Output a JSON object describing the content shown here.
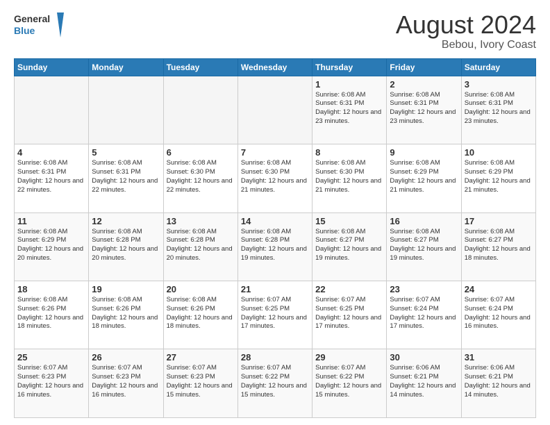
{
  "logo": {
    "line1": "General",
    "line2": "Blue"
  },
  "header": {
    "month": "August 2024",
    "location": "Bebou, Ivory Coast"
  },
  "days_of_week": [
    "Sunday",
    "Monday",
    "Tuesday",
    "Wednesday",
    "Thursday",
    "Friday",
    "Saturday"
  ],
  "weeks": [
    [
      {
        "day": "",
        "sunrise": "",
        "sunset": "",
        "daylight": ""
      },
      {
        "day": "",
        "sunrise": "",
        "sunset": "",
        "daylight": ""
      },
      {
        "day": "",
        "sunrise": "",
        "sunset": "",
        "daylight": ""
      },
      {
        "day": "",
        "sunrise": "",
        "sunset": "",
        "daylight": ""
      },
      {
        "day": "1",
        "sunrise": "Sunrise: 6:08 AM",
        "sunset": "Sunset: 6:31 PM",
        "daylight": "Daylight: 12 hours and 23 minutes."
      },
      {
        "day": "2",
        "sunrise": "Sunrise: 6:08 AM",
        "sunset": "Sunset: 6:31 PM",
        "daylight": "Daylight: 12 hours and 23 minutes."
      },
      {
        "day": "3",
        "sunrise": "Sunrise: 6:08 AM",
        "sunset": "Sunset: 6:31 PM",
        "daylight": "Daylight: 12 hours and 23 minutes."
      }
    ],
    [
      {
        "day": "4",
        "sunrise": "Sunrise: 6:08 AM",
        "sunset": "Sunset: 6:31 PM",
        "daylight": "Daylight: 12 hours and 22 minutes."
      },
      {
        "day": "5",
        "sunrise": "Sunrise: 6:08 AM",
        "sunset": "Sunset: 6:31 PM",
        "daylight": "Daylight: 12 hours and 22 minutes."
      },
      {
        "day": "6",
        "sunrise": "Sunrise: 6:08 AM",
        "sunset": "Sunset: 6:30 PM",
        "daylight": "Daylight: 12 hours and 22 minutes."
      },
      {
        "day": "7",
        "sunrise": "Sunrise: 6:08 AM",
        "sunset": "Sunset: 6:30 PM",
        "daylight": "Daylight: 12 hours and 21 minutes."
      },
      {
        "day": "8",
        "sunrise": "Sunrise: 6:08 AM",
        "sunset": "Sunset: 6:30 PM",
        "daylight": "Daylight: 12 hours and 21 minutes."
      },
      {
        "day": "9",
        "sunrise": "Sunrise: 6:08 AM",
        "sunset": "Sunset: 6:29 PM",
        "daylight": "Daylight: 12 hours and 21 minutes."
      },
      {
        "day": "10",
        "sunrise": "Sunrise: 6:08 AM",
        "sunset": "Sunset: 6:29 PM",
        "daylight": "Daylight: 12 hours and 21 minutes."
      }
    ],
    [
      {
        "day": "11",
        "sunrise": "Sunrise: 6:08 AM",
        "sunset": "Sunset: 6:29 PM",
        "daylight": "Daylight: 12 hours and 20 minutes."
      },
      {
        "day": "12",
        "sunrise": "Sunrise: 6:08 AM",
        "sunset": "Sunset: 6:28 PM",
        "daylight": "Daylight: 12 hours and 20 minutes."
      },
      {
        "day": "13",
        "sunrise": "Sunrise: 6:08 AM",
        "sunset": "Sunset: 6:28 PM",
        "daylight": "Daylight: 12 hours and 20 minutes."
      },
      {
        "day": "14",
        "sunrise": "Sunrise: 6:08 AM",
        "sunset": "Sunset: 6:28 PM",
        "daylight": "Daylight: 12 hours and 19 minutes."
      },
      {
        "day": "15",
        "sunrise": "Sunrise: 6:08 AM",
        "sunset": "Sunset: 6:27 PM",
        "daylight": "Daylight: 12 hours and 19 minutes."
      },
      {
        "day": "16",
        "sunrise": "Sunrise: 6:08 AM",
        "sunset": "Sunset: 6:27 PM",
        "daylight": "Daylight: 12 hours and 19 minutes."
      },
      {
        "day": "17",
        "sunrise": "Sunrise: 6:08 AM",
        "sunset": "Sunset: 6:27 PM",
        "daylight": "Daylight: 12 hours and 18 minutes."
      }
    ],
    [
      {
        "day": "18",
        "sunrise": "Sunrise: 6:08 AM",
        "sunset": "Sunset: 6:26 PM",
        "daylight": "Daylight: 12 hours and 18 minutes."
      },
      {
        "day": "19",
        "sunrise": "Sunrise: 6:08 AM",
        "sunset": "Sunset: 6:26 PM",
        "daylight": "Daylight: 12 hours and 18 minutes."
      },
      {
        "day": "20",
        "sunrise": "Sunrise: 6:08 AM",
        "sunset": "Sunset: 6:26 PM",
        "daylight": "Daylight: 12 hours and 18 minutes."
      },
      {
        "day": "21",
        "sunrise": "Sunrise: 6:07 AM",
        "sunset": "Sunset: 6:25 PM",
        "daylight": "Daylight: 12 hours and 17 minutes."
      },
      {
        "day": "22",
        "sunrise": "Sunrise: 6:07 AM",
        "sunset": "Sunset: 6:25 PM",
        "daylight": "Daylight: 12 hours and 17 minutes."
      },
      {
        "day": "23",
        "sunrise": "Sunrise: 6:07 AM",
        "sunset": "Sunset: 6:24 PM",
        "daylight": "Daylight: 12 hours and 17 minutes."
      },
      {
        "day": "24",
        "sunrise": "Sunrise: 6:07 AM",
        "sunset": "Sunset: 6:24 PM",
        "daylight": "Daylight: 12 hours and 16 minutes."
      }
    ],
    [
      {
        "day": "25",
        "sunrise": "Sunrise: 6:07 AM",
        "sunset": "Sunset: 6:23 PM",
        "daylight": "Daylight: 12 hours and 16 minutes."
      },
      {
        "day": "26",
        "sunrise": "Sunrise: 6:07 AM",
        "sunset": "Sunset: 6:23 PM",
        "daylight": "Daylight: 12 hours and 16 minutes."
      },
      {
        "day": "27",
        "sunrise": "Sunrise: 6:07 AM",
        "sunset": "Sunset: 6:23 PM",
        "daylight": "Daylight: 12 hours and 15 minutes."
      },
      {
        "day": "28",
        "sunrise": "Sunrise: 6:07 AM",
        "sunset": "Sunset: 6:22 PM",
        "daylight": "Daylight: 12 hours and 15 minutes."
      },
      {
        "day": "29",
        "sunrise": "Sunrise: 6:07 AM",
        "sunset": "Sunset: 6:22 PM",
        "daylight": "Daylight: 12 hours and 15 minutes."
      },
      {
        "day": "30",
        "sunrise": "Sunrise: 6:06 AM",
        "sunset": "Sunset: 6:21 PM",
        "daylight": "Daylight: 12 hours and 14 minutes."
      },
      {
        "day": "31",
        "sunrise": "Sunrise: 6:06 AM",
        "sunset": "Sunset: 6:21 PM",
        "daylight": "Daylight: 12 hours and 14 minutes."
      }
    ]
  ]
}
